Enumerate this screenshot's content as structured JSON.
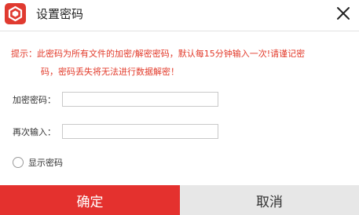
{
  "window": {
    "title": "设置密码",
    "icon": "app-logo-icon",
    "close_icon": "close-icon"
  },
  "notice": {
    "line1": "提示：此密码为所有文件的加密/解密密码，默认每15分钟输入一次!请谨记密",
    "line2": "码，密码丢失将无法进行数据解密！",
    "color": "#e23a2a"
  },
  "form": {
    "password_label": "加密密码：",
    "password_value": "",
    "confirm_label": "再次输入：",
    "confirm_value": "",
    "show_password_label": "显示密码",
    "show_password_checked": false
  },
  "buttons": {
    "ok_label": "确定",
    "cancel_label": "取消",
    "ok_color": "#e4312e",
    "cancel_color": "#e7e7e7"
  }
}
